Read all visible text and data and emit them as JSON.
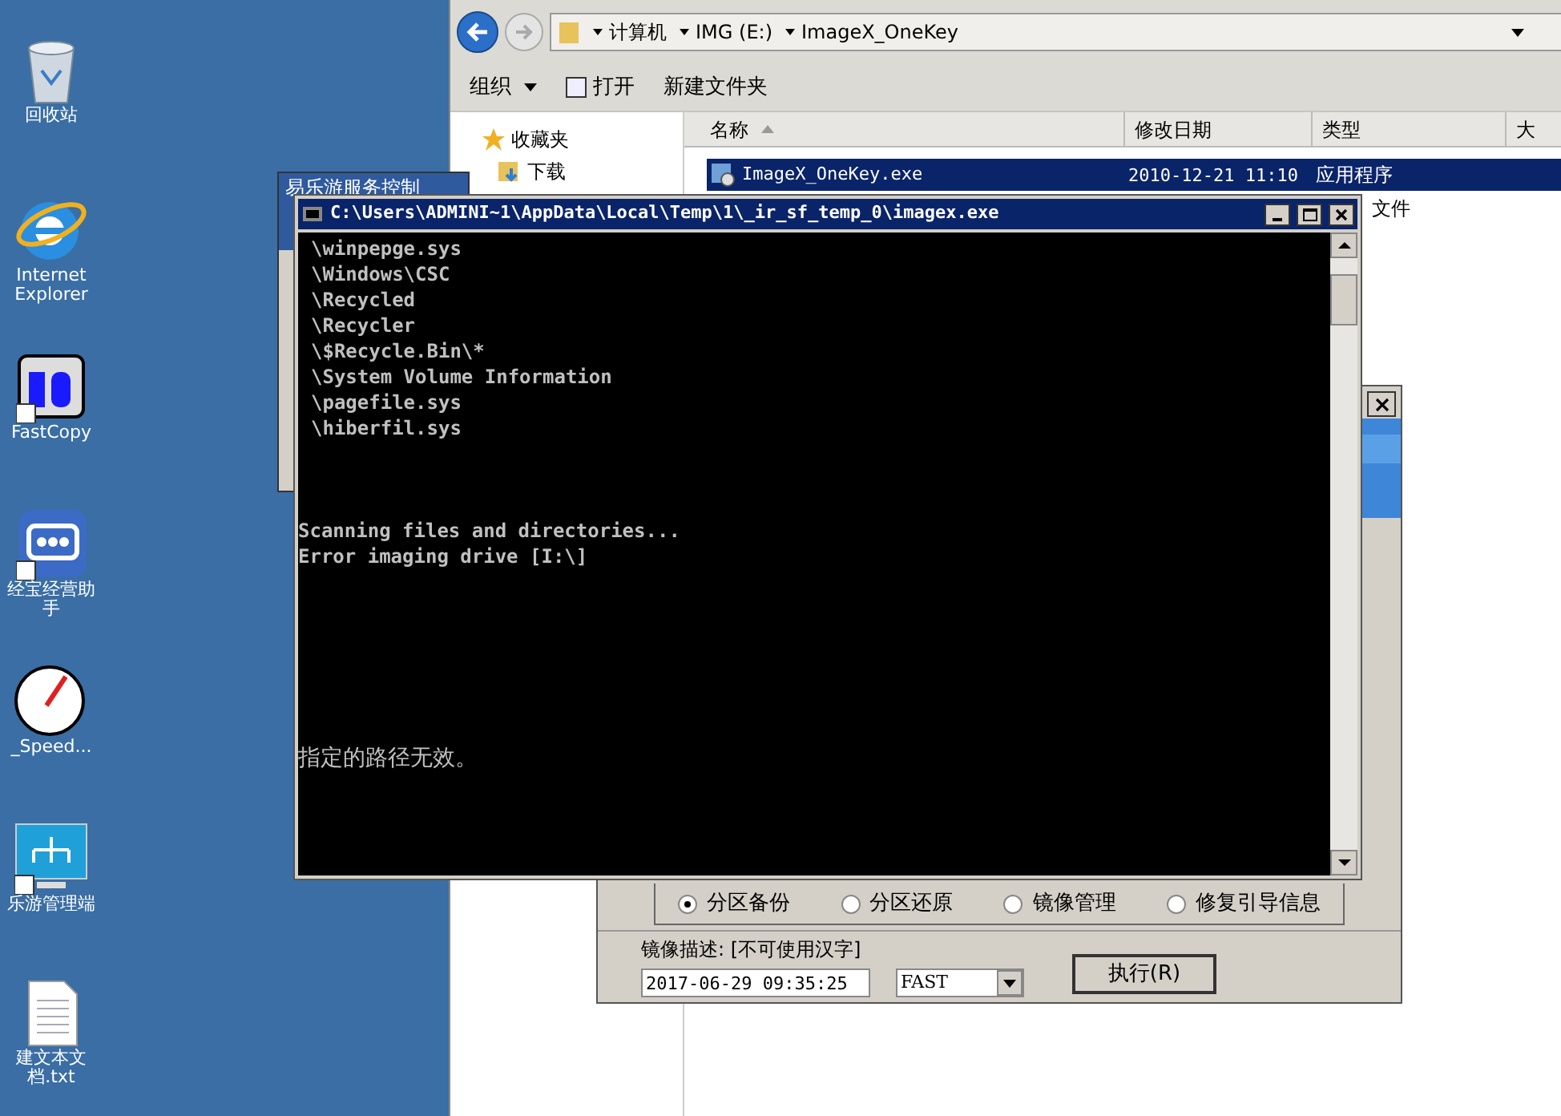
{
  "desktop_icons": [
    {
      "kind": "recycle",
      "label": "回收站"
    },
    {
      "kind": "ie",
      "label": "Internet Explorer"
    },
    {
      "kind": "fastcopy",
      "label": "FastCopy"
    },
    {
      "kind": "app",
      "label": "经宝经营助手"
    },
    {
      "kind": "speed",
      "label": "_Speed..."
    },
    {
      "kind": "network",
      "label": "乐游管理端"
    },
    {
      "kind": "text",
      "label": "建文本文档.txt"
    }
  ],
  "explorer": {
    "breadcrumb": [
      "计算机",
      "IMG (E:)",
      "ImageX_OneKey"
    ],
    "toolbar": [
      "组织",
      "打开",
      "新建文件夹"
    ],
    "nav": [
      {
        "kind": "favorites",
        "label": "收藏夹"
      },
      {
        "kind": "downloads",
        "label": "下载"
      }
    ],
    "columns": [
      "名称",
      "修改日期",
      "类型",
      "大"
    ],
    "rows": [
      {
        "name": "ImageX_OneKey.exe",
        "date": "2010-12-21 11:10",
        "type": "应用程序",
        "selected": true
      },
      {
        "type": "文件",
        "selected": false
      }
    ]
  },
  "back_window": {
    "title": "易乐游服务控制"
  },
  "console": {
    "title": "C:\\Users\\ADMINI~1\\AppData\\Local\\Temp\\1\\_ir_sf_temp_0\\imagex.exe",
    "lines": [
      "\\winpepge.sys",
      "\\Windows\\CSC",
      "\\Recycled",
      "\\Recycler",
      "\\$Recycle.Bin\\*",
      "\\System Volume Information",
      "\\pagefile.sys",
      "\\hiberfil.sys"
    ],
    "status": [
      "Scanning files and directories...",
      "Error imaging drive [I:\\]"
    ],
    "message": "指定的路径无效。"
  },
  "dialog": {
    "modes": [
      {
        "label": "分区备份",
        "selected": true
      },
      {
        "label": "分区还原",
        "selected": false
      },
      {
        "label": "镜像管理",
        "selected": false
      },
      {
        "label": "修复引导信息",
        "selected": false
      }
    ],
    "description_label": "镜像描述: [不可使用汉字]",
    "description_value": "2017-06-29 09:35:25",
    "compression": "FAST",
    "run_button": "执行(R)"
  }
}
